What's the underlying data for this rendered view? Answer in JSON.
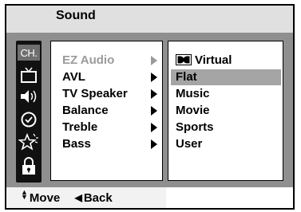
{
  "header": {
    "title": "Sound"
  },
  "side_icons": [
    {
      "name": "ch-icon",
      "text": "CH."
    },
    {
      "name": "tv-icon"
    },
    {
      "name": "speaker-icon"
    },
    {
      "name": "clock-icon"
    },
    {
      "name": "star-icon"
    },
    {
      "name": "lock-icon"
    }
  ],
  "menu": {
    "items": [
      {
        "label": "EZ Audio",
        "active": true
      },
      {
        "label": "AVL"
      },
      {
        "label": "TV Speaker"
      },
      {
        "label": "Balance"
      },
      {
        "label": "Treble"
      },
      {
        "label": "Bass"
      }
    ]
  },
  "submenu": {
    "items": [
      {
        "label": "Virtual",
        "icon": "dolby-icon"
      },
      {
        "label": "Flat",
        "selected": true
      },
      {
        "label": "Music"
      },
      {
        "label": "Movie"
      },
      {
        "label": "Sports"
      },
      {
        "label": "User"
      }
    ]
  },
  "help": {
    "move_label": "Move",
    "back_label": "Back"
  },
  "colors": {
    "title_bg": "#e0e0e0",
    "panel_bg": "#8f8f8f",
    "selected_bg": "#a5a5a5",
    "dim_text": "#9a9a9a"
  }
}
